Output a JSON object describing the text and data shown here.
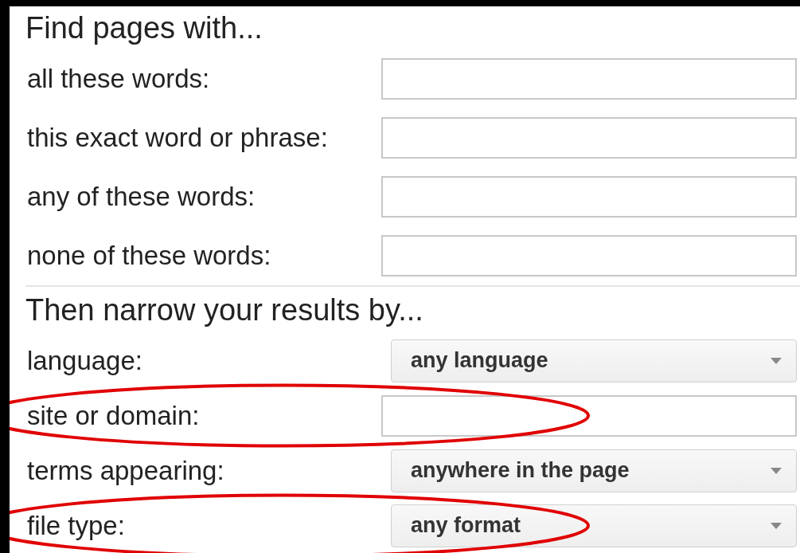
{
  "sections": [
    {
      "heading": "Find pages with...",
      "fields": [
        {
          "kind": "text",
          "label": "all these words:",
          "circled": false
        },
        {
          "kind": "text",
          "label": "this exact word or phrase:",
          "circled": false
        },
        {
          "kind": "text",
          "label": "any of these words:",
          "circled": false
        },
        {
          "kind": "text",
          "label": "none of these words:",
          "circled": false
        }
      ]
    },
    {
      "heading": "Then narrow your results by...",
      "fields": [
        {
          "kind": "select",
          "label": "language:",
          "value": "any language",
          "circled": false
        },
        {
          "kind": "text",
          "label": "site or domain:",
          "circled": true
        },
        {
          "kind": "select",
          "label": "terms appearing:",
          "value": "anywhere in the page",
          "circled": false
        },
        {
          "kind": "select",
          "label": "file type:",
          "value": "any format",
          "circled": true
        }
      ]
    }
  ]
}
